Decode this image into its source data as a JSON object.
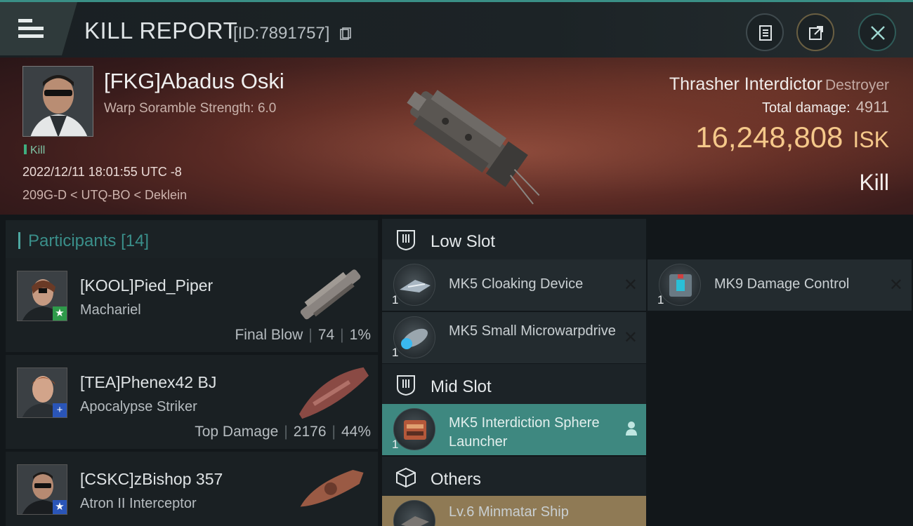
{
  "header": {
    "title": "KILL REPORT",
    "report_id": "[ID:7891757]"
  },
  "victim": {
    "name": "[FKG]Abadus Oski",
    "warp_scramble": "Warp Soramble Strength: 6.0",
    "tag": "Kill",
    "datetime": "2022/12/11 18:01:55 UTC -8",
    "location": "209G-D < UTQ-BO < Deklein",
    "ship_name": "Thrasher Interdictor",
    "ship_class": "Destroyer",
    "total_damage_label": "Total damage:",
    "total_damage": "4911",
    "isk_value": "16,248,808",
    "isk_unit": "ISK",
    "result": "Kill"
  },
  "participants": {
    "label": "Participants",
    "count": "[14]",
    "items": [
      {
        "name": "[KOOL]Pied_Piper",
        "ship": "Machariel",
        "role": "Final Blow",
        "damage": "74",
        "percent": "1%",
        "badge": "★",
        "badge_color": "#2e9a4a"
      },
      {
        "name": "[TEA]Phenex42 BJ",
        "ship": "Apocalypse Striker",
        "role": "Top Damage",
        "damage": "2176",
        "percent": "44%",
        "badge": "+",
        "badge_color": "#2a55b8"
      },
      {
        "name": "[CSKC]zBishop 357",
        "ship": "Atron II Interceptor",
        "role": "",
        "damage": "",
        "percent": "",
        "badge": "★",
        "badge_color": "#2a55b8"
      }
    ]
  },
  "slots": {
    "low": {
      "label": "Low Slot",
      "modules": [
        {
          "name": "MK5 Cloaking Device",
          "qty": "1"
        },
        {
          "name": "MK9 Damage Control",
          "qty": "1"
        },
        {
          "name": "MK5 Small Microwarpdrive",
          "qty": "1"
        }
      ]
    },
    "mid": {
      "label": "Mid Slot",
      "modules": [
        {
          "name": "MK5 Interdiction Sphere Launcher",
          "qty": "1"
        }
      ]
    },
    "others": {
      "label": "Others",
      "modules": [
        {
          "name": "Lv.6 Minmatar Ship"
        }
      ]
    }
  },
  "colors": {
    "accent": "#3a8f86",
    "isk": "#f5c88a",
    "active_module": "#3e8880",
    "cargo_module": "#8f7a55"
  }
}
